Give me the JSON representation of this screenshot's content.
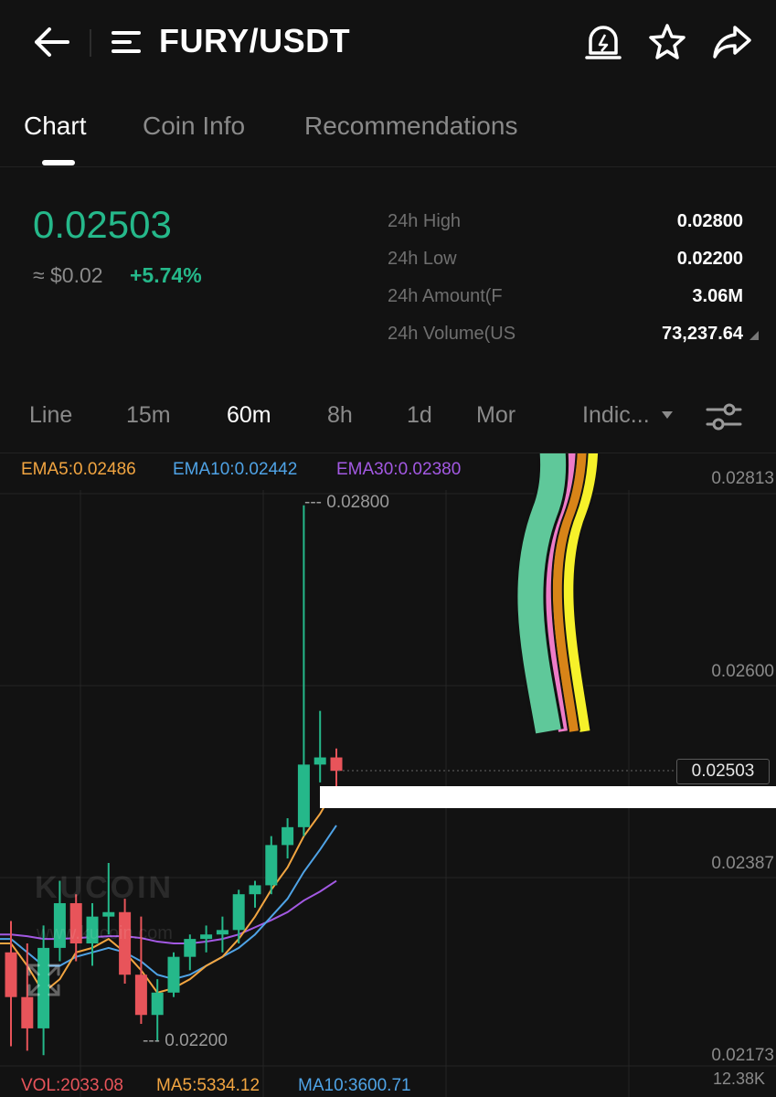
{
  "header": {
    "title": "FURY/USDT",
    "icons": [
      "back-arrow-icon",
      "menu-icon",
      "price-alert-icon",
      "star-icon",
      "share-icon"
    ]
  },
  "tabs": [
    {
      "label": "Chart",
      "active": true
    },
    {
      "label": "Coin Info",
      "active": false
    },
    {
      "label": "Recommendations",
      "active": false
    }
  ],
  "price": {
    "last": "0.02503",
    "fiat": "≈ $0.02",
    "change": "+5.74%"
  },
  "stats": [
    {
      "label": "24h High",
      "value": "0.02800"
    },
    {
      "label": "24h Low",
      "value": "0.02200"
    },
    {
      "label": "24h Amount(F",
      "value": "3.06M"
    },
    {
      "label": "24h Volume(US",
      "value": "73,237.64"
    }
  ],
  "intervals": [
    {
      "label": "Line",
      "active": false
    },
    {
      "label": "15m",
      "active": false
    },
    {
      "label": "60m",
      "active": true
    },
    {
      "label": "8h",
      "active": false
    },
    {
      "label": "1d",
      "active": false
    },
    {
      "label": "Mor",
      "active": false
    },
    {
      "label": "Indic...",
      "active": false
    }
  ],
  "ema_legend": {
    "ema5": "EMA5:0.02486",
    "ema10": "EMA10:0.02442",
    "ema30": "EMA30:0.02380"
  },
  "axis": {
    "labels": [
      "0.02813",
      "0.02600",
      "0.02387",
      "0.02173"
    ],
    "current": "0.02503",
    "high_marker": "0.02800",
    "low_marker": "0.02200",
    "volume_max": "12.38K"
  },
  "volume_legend": {
    "vol": "VOL:2033.08",
    "ma5": "MA5:5334.12",
    "ma10": "MA10:3600.71"
  },
  "watermark": {
    "brand": "KUCOIN",
    "url": "www.kucoin.com"
  },
  "colors": {
    "up": "#25b88a",
    "down": "#e8545a",
    "ema5": "#f2a541",
    "ema10": "#4fa3e6",
    "ema30": "#a359e3",
    "background": "#121212"
  },
  "chart_data": {
    "type": "candlestick",
    "interval": "60m",
    "ylim": [
      0.02173,
      0.02813
    ],
    "y_ticks": [
      0.02813,
      0.026,
      0.02387,
      0.02173
    ],
    "candles": [
      {
        "o": 0.023,
        "h": 0.02335,
        "l": 0.02195,
        "c": 0.0225
      },
      {
        "o": 0.0225,
        "h": 0.0231,
        "l": 0.0219,
        "c": 0.02215
      },
      {
        "o": 0.02215,
        "h": 0.0233,
        "l": 0.02185,
        "c": 0.02305
      },
      {
        "o": 0.02305,
        "h": 0.0238,
        "l": 0.0229,
        "c": 0.02355
      },
      {
        "o": 0.02355,
        "h": 0.02365,
        "l": 0.0229,
        "c": 0.0231
      },
      {
        "o": 0.0231,
        "h": 0.02355,
        "l": 0.02285,
        "c": 0.0234
      },
      {
        "o": 0.0234,
        "h": 0.024,
        "l": 0.0232,
        "c": 0.02345
      },
      {
        "o": 0.02345,
        "h": 0.0236,
        "l": 0.02265,
        "c": 0.02275
      },
      {
        "o": 0.02275,
        "h": 0.0234,
        "l": 0.0222,
        "c": 0.0223
      },
      {
        "o": 0.0223,
        "h": 0.0227,
        "l": 0.022,
        "c": 0.02255
      },
      {
        "o": 0.02255,
        "h": 0.023,
        "l": 0.0225,
        "c": 0.02295
      },
      {
        "o": 0.02295,
        "h": 0.0232,
        "l": 0.0228,
        "c": 0.02315
      },
      {
        "o": 0.02315,
        "h": 0.0233,
        "l": 0.023,
        "c": 0.0232
      },
      {
        "o": 0.0232,
        "h": 0.0234,
        "l": 0.023,
        "c": 0.02325
      },
      {
        "o": 0.02325,
        "h": 0.0237,
        "l": 0.0231,
        "c": 0.02365
      },
      {
        "o": 0.02365,
        "h": 0.0238,
        "l": 0.0235,
        "c": 0.02375
      },
      {
        "o": 0.02375,
        "h": 0.0243,
        "l": 0.02365,
        "c": 0.0242
      },
      {
        "o": 0.0242,
        "h": 0.0245,
        "l": 0.02405,
        "c": 0.0244
      },
      {
        "o": 0.0244,
        "h": 0.028,
        "l": 0.0243,
        "c": 0.0251
      },
      {
        "o": 0.0251,
        "h": 0.0257,
        "l": 0.0249,
        "c": 0.02518
      },
      {
        "o": 0.02518,
        "h": 0.02528,
        "l": 0.0248,
        "c": 0.02503
      }
    ],
    "ema5": [
      0.0231,
      0.02285,
      0.02255,
      0.0227,
      0.023,
      0.02305,
      0.02315,
      0.023,
      0.0228,
      0.02255,
      0.0226,
      0.0227,
      0.02285,
      0.02295,
      0.02315,
      0.0234,
      0.0237,
      0.02395,
      0.0243,
      0.02455,
      0.02486
    ],
    "ema10": [
      0.02315,
      0.023,
      0.02285,
      0.02285,
      0.02295,
      0.023,
      0.02305,
      0.023,
      0.0229,
      0.02275,
      0.0227,
      0.02275,
      0.02285,
      0.02295,
      0.02305,
      0.0232,
      0.0234,
      0.0236,
      0.0239,
      0.02415,
      0.02442
    ],
    "ema30": [
      0.0232,
      0.02318,
      0.02315,
      0.02315,
      0.02316,
      0.02317,
      0.02318,
      0.02318,
      0.02316,
      0.02312,
      0.0231,
      0.0231,
      0.02312,
      0.02315,
      0.0232,
      0.02328,
      0.02336,
      0.02345,
      0.02358,
      0.02368,
      0.0238
    ]
  }
}
